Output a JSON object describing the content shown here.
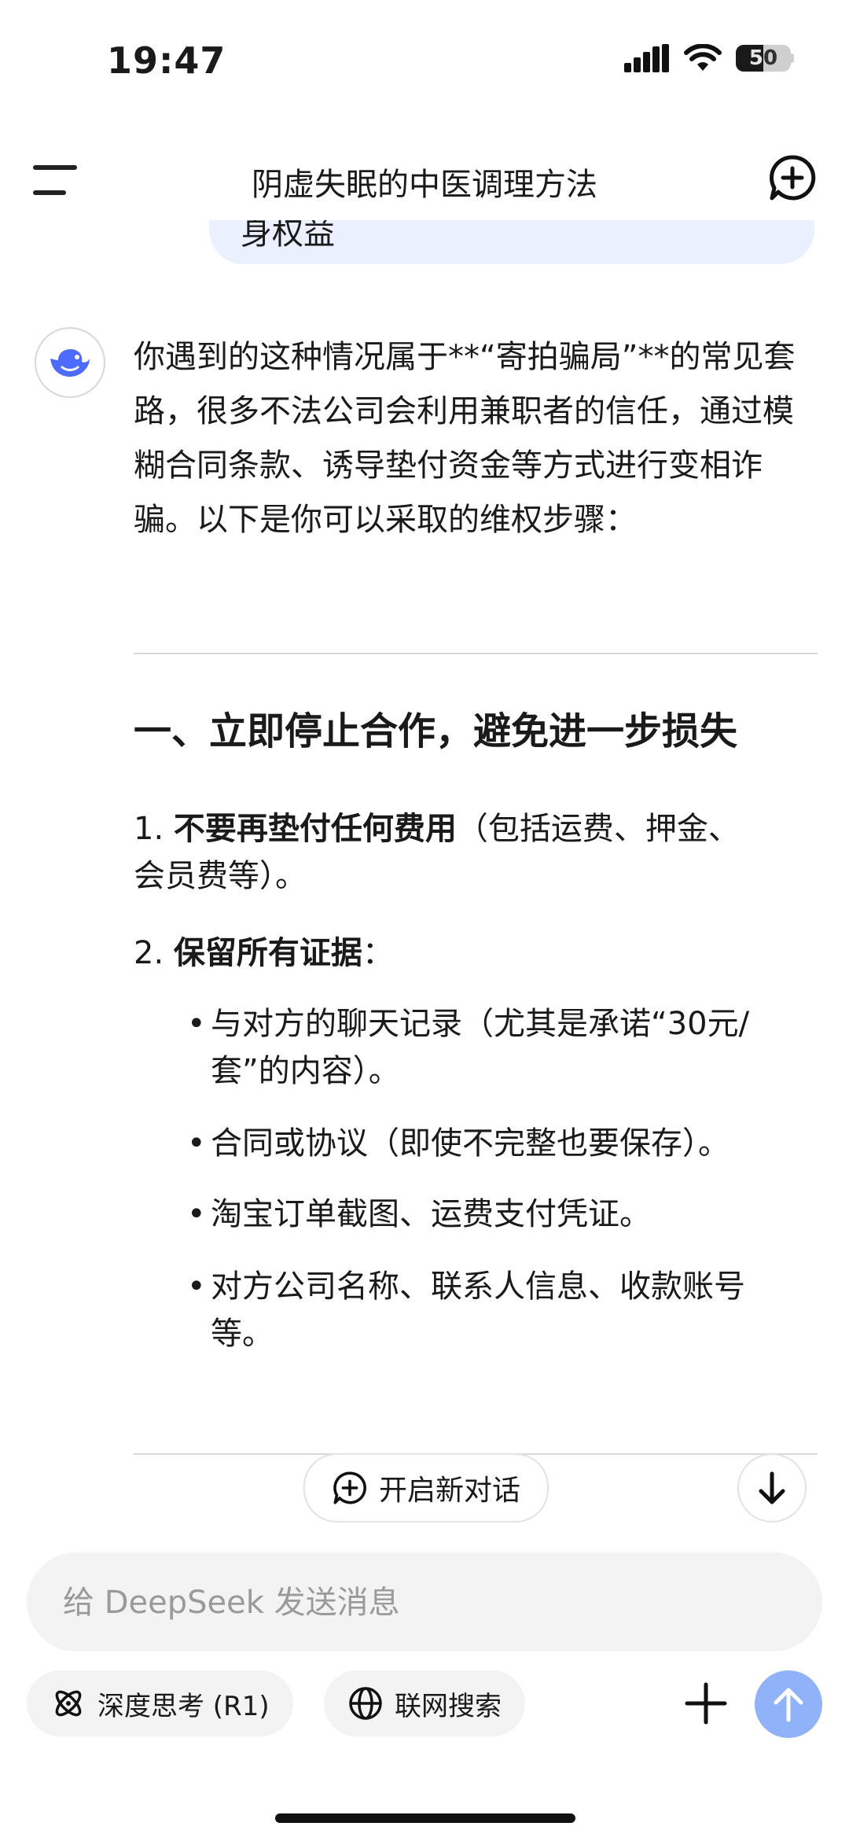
{
  "status_bar": {
    "time": "19:47",
    "battery_level": "50"
  },
  "header": {
    "title": "阴虚失眠的中医调理方法",
    "menu_icon": "menu-icon",
    "new_chat_icon": "new-chat-icon"
  },
  "user_message_tail": "身权益",
  "assistant": {
    "intro": "你遇到的这种情况属于**“寄拍骗局”**的常见套路，很多不法公司会利用兼职者的信任，通过模糊合同条款、诱导垫付资金等方式进行变相诈骗。以下是你可以采取的维权步骤：",
    "section1_title": "一、立即停止合作，避免进一步损失",
    "items": [
      {
        "num": "1.",
        "bold": "不要再垫付任何费用",
        "rest": "（包括运费、押金、会员费等）。"
      },
      {
        "num": "2.",
        "bold": "保留所有证据",
        "rest": "："
      }
    ],
    "bullets": [
      "与对方的聊天记录（尤其是承诺“30元/套”的内容）。",
      "合同或协议（即使不完整也要保存）。",
      "淘宝订单截图、运费支付凭证。",
      "对方公司名称、联系人信息、收款账号等。"
    ]
  },
  "floating": {
    "new_chat_label": "开启新对话"
  },
  "composer": {
    "placeholder": "给 DeepSeek 发送消息",
    "deep_think_label": "深度思考 (R1)",
    "web_search_label": "联网搜索"
  },
  "colors": {
    "accent": "#4d6bfe",
    "send_disabled": "#8fb2f8",
    "bubble": "#eaf0fe"
  }
}
